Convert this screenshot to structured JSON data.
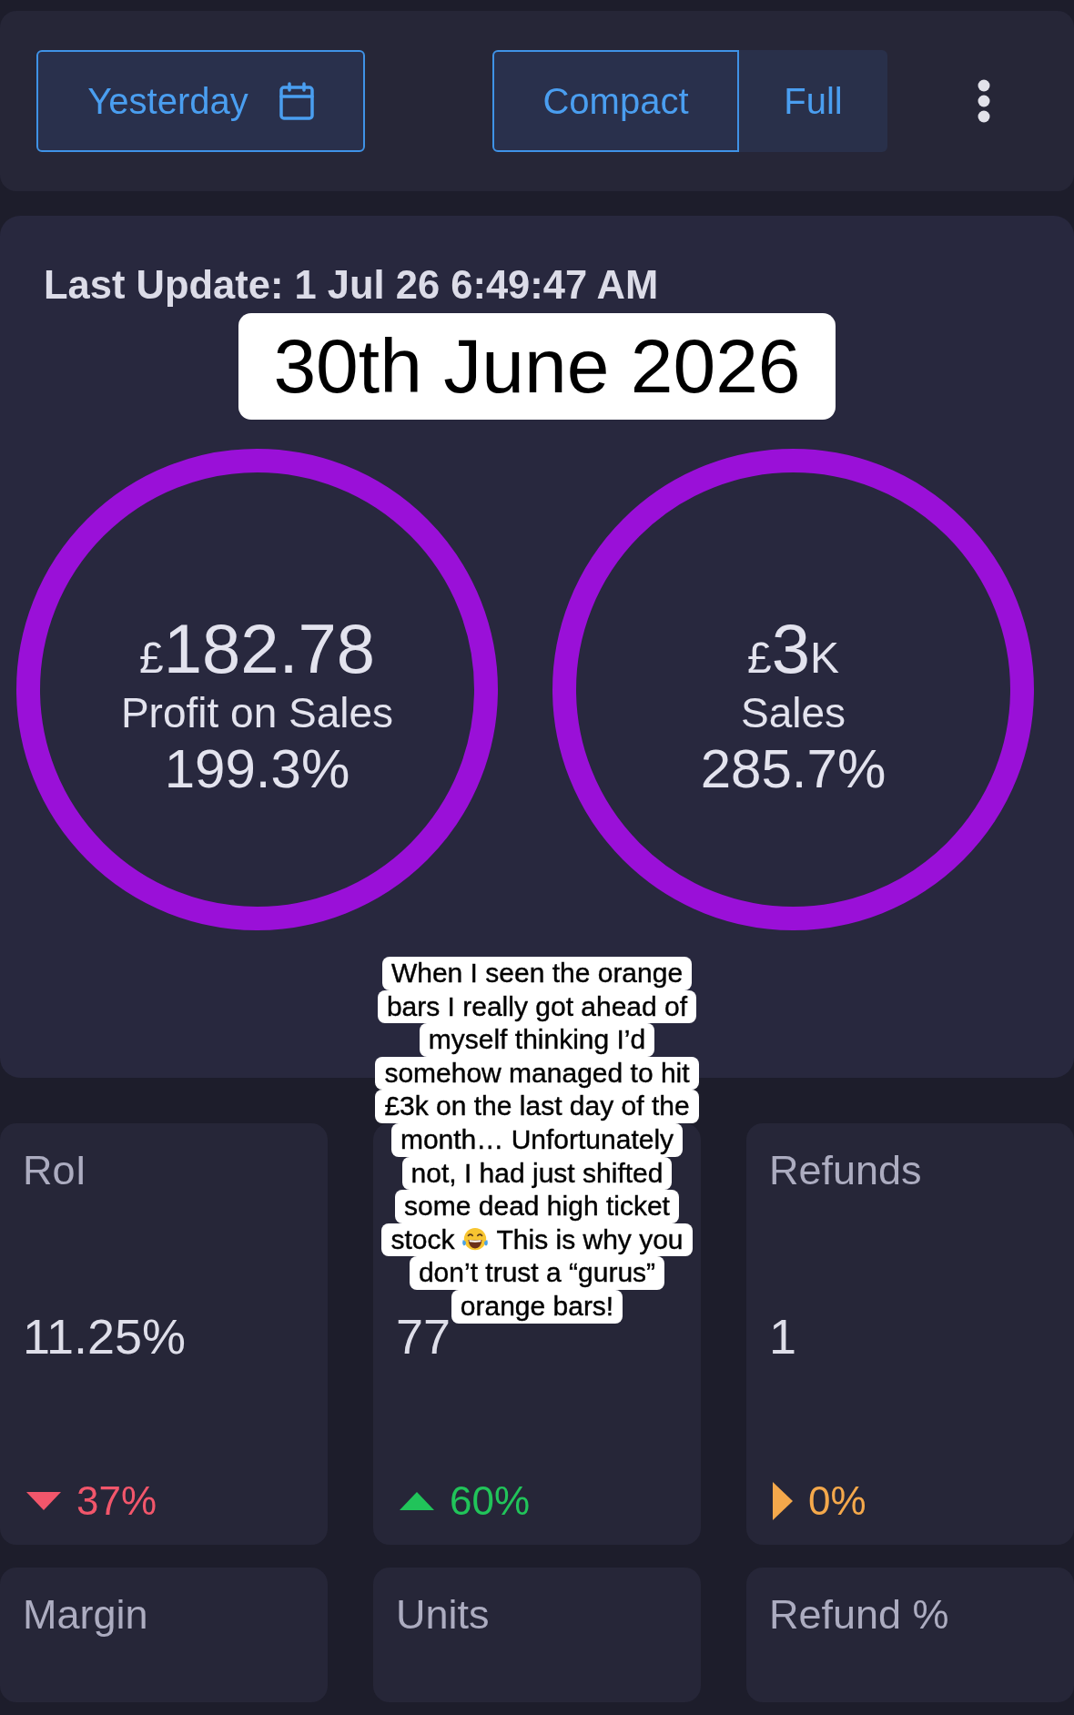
{
  "toolbar": {
    "date_button": {
      "label": "Yesterday"
    },
    "view_toggle": [
      {
        "label": "Compact",
        "selected": true
      },
      {
        "label": "Full",
        "selected": false
      }
    ]
  },
  "summary": {
    "last_update": "Last Update: 1 Jul 26 6:49:47 AM",
    "date_title": "30th June 2026",
    "rings": [
      {
        "currency": "£",
        "amount": "182.78",
        "label": "Profit on Sales",
        "percent": "199.3%"
      },
      {
        "currency": "£",
        "amount": "3",
        "suffix": "K",
        "label": "Sales",
        "percent": "285.7%"
      }
    ]
  },
  "caption": {
    "lines": [
      {
        "text": "When I seen the orange",
        "emoji": false
      },
      {
        "text": "bars I really got ahead of",
        "emoji": false
      },
      {
        "text": "myself thinking I’d",
        "emoji": false
      },
      {
        "text": "somehow managed to hit",
        "emoji": false
      },
      {
        "text": "£3k on the last day of the",
        "emoji": false
      },
      {
        "text": "month… Unfortunately",
        "emoji": false
      },
      {
        "text": "not, I had just shifted",
        "emoji": false
      },
      {
        "text": "some dead high ticket",
        "emoji": false
      },
      {
        "text": "stock",
        "emoji": true,
        "text_after": "This is why you"
      },
      {
        "text": "don’t trust a “gurus”",
        "emoji": false
      },
      {
        "text": "orange bars!",
        "emoji": false
      }
    ]
  },
  "stat_cards": [
    {
      "title": "RoI",
      "value": "11.25%",
      "kind": "down",
      "change": "37%"
    },
    {
      "value": "77",
      "kind": "up",
      "change": "60%"
    },
    {
      "title": "Refunds",
      "value": "1",
      "kind": "flat",
      "change": "0%"
    }
  ],
  "more_cards": [
    {
      "title": "Margin"
    },
    {
      "title": "Units"
    },
    {
      "title": "Refund %"
    }
  ]
}
